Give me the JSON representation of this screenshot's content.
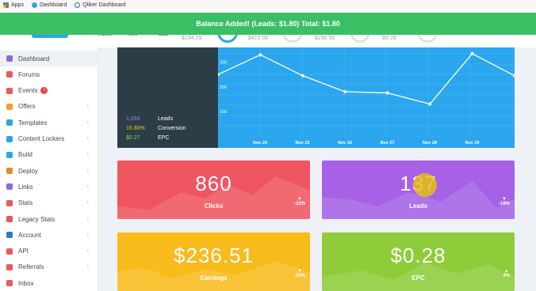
{
  "bookmarks": [
    {
      "label": "Apps",
      "icon": "apps-grid-icon"
    },
    {
      "label": "Dashboard",
      "icon": "dashboard-icon"
    },
    {
      "label": "Qliker Dashboard",
      "icon": "qliker-icon"
    }
  ],
  "header": {
    "countdown": [
      "HOUR",
      "MIN",
      "SEC"
    ],
    "stats": [
      "$194.29",
      "$415.06",
      "$290.56",
      "$9.28"
    ]
  },
  "notification": {
    "text": "Balance Added! (Leads: $1.80) Total: $1.80",
    "color": "#3bbf65"
  },
  "sidebar": {
    "items": [
      {
        "label": "Dashboard",
        "icon": "dashboard-icon",
        "color": "#8e6bd8",
        "arrow": ""
      },
      {
        "label": "Forums",
        "icon": "chat-bubble-icon",
        "color": "#e65a5a",
        "arrow": ""
      },
      {
        "label": "Events",
        "icon": "megaphone-icon",
        "color": "#e65a5a",
        "arrow": "",
        "badge": "!"
      },
      {
        "label": "Offers",
        "icon": "gift-icon",
        "color": "#f39c33",
        "arrow": "›"
      },
      {
        "label": "Templates",
        "icon": "template-icon",
        "color": "#2aa9de",
        "arrow": "›"
      },
      {
        "label": "Content Lockers",
        "icon": "lock-icon",
        "color": "#2aa9de",
        "arrow": "›"
      },
      {
        "label": "Build",
        "icon": "wrench-icon",
        "color": "#2aa9de",
        "arrow": "›"
      },
      {
        "label": "Deploy",
        "icon": "briefcase-icon",
        "color": "#e08a2e",
        "arrow": "›"
      },
      {
        "label": "Links",
        "icon": "link-icon",
        "color": "#8e6bd8",
        "arrow": "›"
      },
      {
        "label": "Stats",
        "icon": "bar-chart-icon",
        "color": "#e65a5a",
        "arrow": "›"
      },
      {
        "label": "Legacy Stats",
        "icon": "bar-chart-icon",
        "color": "#e65a5a",
        "arrow": "›"
      },
      {
        "label": "Account",
        "icon": "user-icon",
        "color": "#2a7fc4",
        "arrow": "›"
      },
      {
        "label": "API",
        "icon": "api-icon",
        "color": "#e65a5a",
        "arrow": "›"
      },
      {
        "label": "Referrals",
        "icon": "globe-icon",
        "color": "#e65a5a",
        "arrow": "›"
      },
      {
        "label": "Inbox",
        "icon": "inbox-icon",
        "color": "#e65a5a",
        "arrow": ""
      }
    ]
  },
  "summary": {
    "rows": [
      {
        "value": "1,094",
        "label": "Leads",
        "color": "#8e7cf0"
      },
      {
        "value": "15.80%",
        "label": "Conversion",
        "color": "#f0c233"
      },
      {
        "value": "$0.27",
        "label": "EPC",
        "color": "#7ed957"
      }
    ]
  },
  "chart_data": {
    "type": "line",
    "categories": [
      "Nov 24",
      "Nov 25",
      "Nov 26",
      "Nov 27",
      "Nov 28",
      "Nov 29"
    ],
    "y_ticks": [
      "300",
      "200",
      "100"
    ],
    "values": [
      250,
      330,
      245,
      180,
      175,
      130,
      335,
      245
    ],
    "ylim": [
      0,
      360
    ],
    "grid": true
  },
  "cards": [
    {
      "value": "860",
      "label": "Clicks",
      "change": "-22%",
      "direction": "down",
      "color": "#ef5560"
    },
    {
      "value": "137",
      "label": "Leads",
      "change": "-18%",
      "direction": "down",
      "color": "#a661e6"
    },
    {
      "value": "$236.51",
      "label": "Earnings",
      "change": "-15%",
      "direction": "down",
      "color": "#f7bb1c"
    },
    {
      "value": "$0.28",
      "label": "EPC",
      "change": "4%",
      "direction": "up",
      "color": "#8fcc39"
    }
  ]
}
